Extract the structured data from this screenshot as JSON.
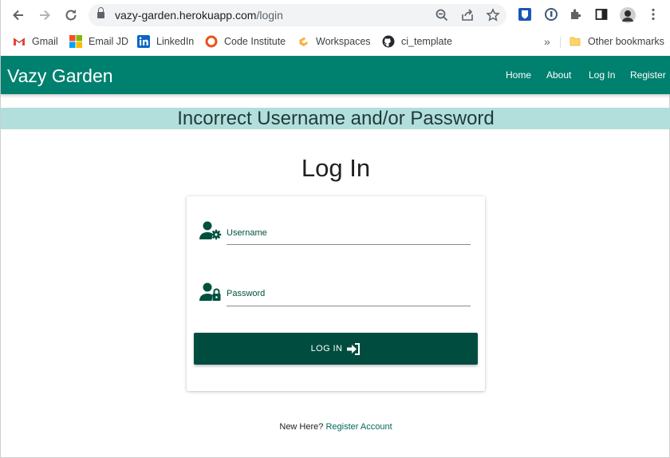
{
  "browser": {
    "url_host": "vazy-garden.herokuapp.com",
    "url_path": "/login",
    "bookmarks": [
      {
        "label": "Gmail",
        "icon": "gmail-icon"
      },
      {
        "label": "Email JD",
        "icon": "microsoft-icon"
      },
      {
        "label": "LinkedIn",
        "icon": "linkedin-icon"
      },
      {
        "label": "Code Institute",
        "icon": "code-institute-icon"
      },
      {
        "label": "Workspaces",
        "icon": "gitpod-icon"
      },
      {
        "label": "ci_template",
        "icon": "github-icon"
      }
    ],
    "more_bookmarks": "»",
    "other_bookmarks": "Other bookmarks"
  },
  "site": {
    "brand": "Vazy Garden",
    "nav": [
      "Home",
      "About",
      "Log In",
      "Register"
    ],
    "accent": "#00806e"
  },
  "flash": {
    "message": "Incorrect Username and/or Password"
  },
  "login": {
    "title": "Log In",
    "username_label": "Username",
    "password_label": "Password",
    "button_label": "LOG IN",
    "button_color": "#004d40"
  },
  "footer": {
    "prompt": "New Here?",
    "link": "Register Account"
  }
}
